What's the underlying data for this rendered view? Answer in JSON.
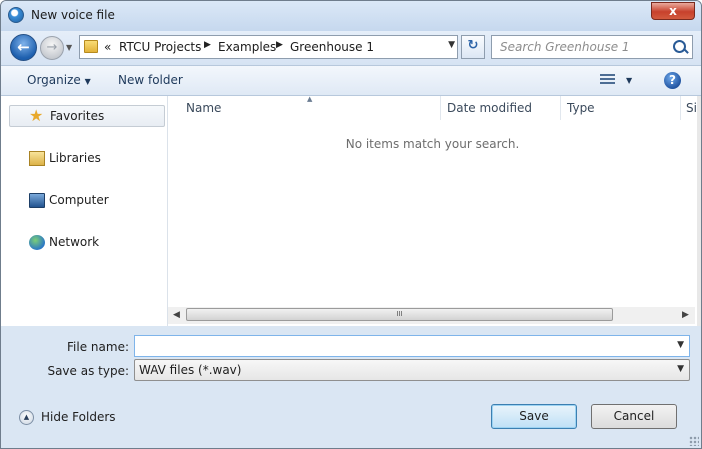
{
  "window": {
    "title": "New voice file",
    "close_label": "x"
  },
  "navbar": {
    "breadcrumbs": [
      "RTCU Projects",
      "Examples",
      "Greenhouse 1"
    ],
    "overflow": "«",
    "search_placeholder": "Search Greenhouse 1"
  },
  "toolbar": {
    "organize": "Organize",
    "new_folder": "New folder"
  },
  "sidebar": {
    "items": [
      {
        "label": "Favorites",
        "icon": "star-icon"
      },
      {
        "label": "Libraries",
        "icon": "libraries-icon"
      },
      {
        "label": "Computer",
        "icon": "computer-icon"
      },
      {
        "label": "Network",
        "icon": "network-icon"
      }
    ]
  },
  "filelist": {
    "columns": [
      "Name",
      "Date modified",
      "Type",
      "Si"
    ],
    "empty_message": "No items match your search.",
    "scroll_grip": "III"
  },
  "form": {
    "filename_label": "File name:",
    "filename_value": "",
    "type_label": "Save as type:",
    "type_value": "WAV files (*.wav)"
  },
  "footer": {
    "hide_folders": "Hide Folders",
    "save": "Save",
    "cancel": "Cancel"
  },
  "colors": {
    "accent": "#1d5fae",
    "frame": "#d9e6f4",
    "close": "#c7412c"
  }
}
